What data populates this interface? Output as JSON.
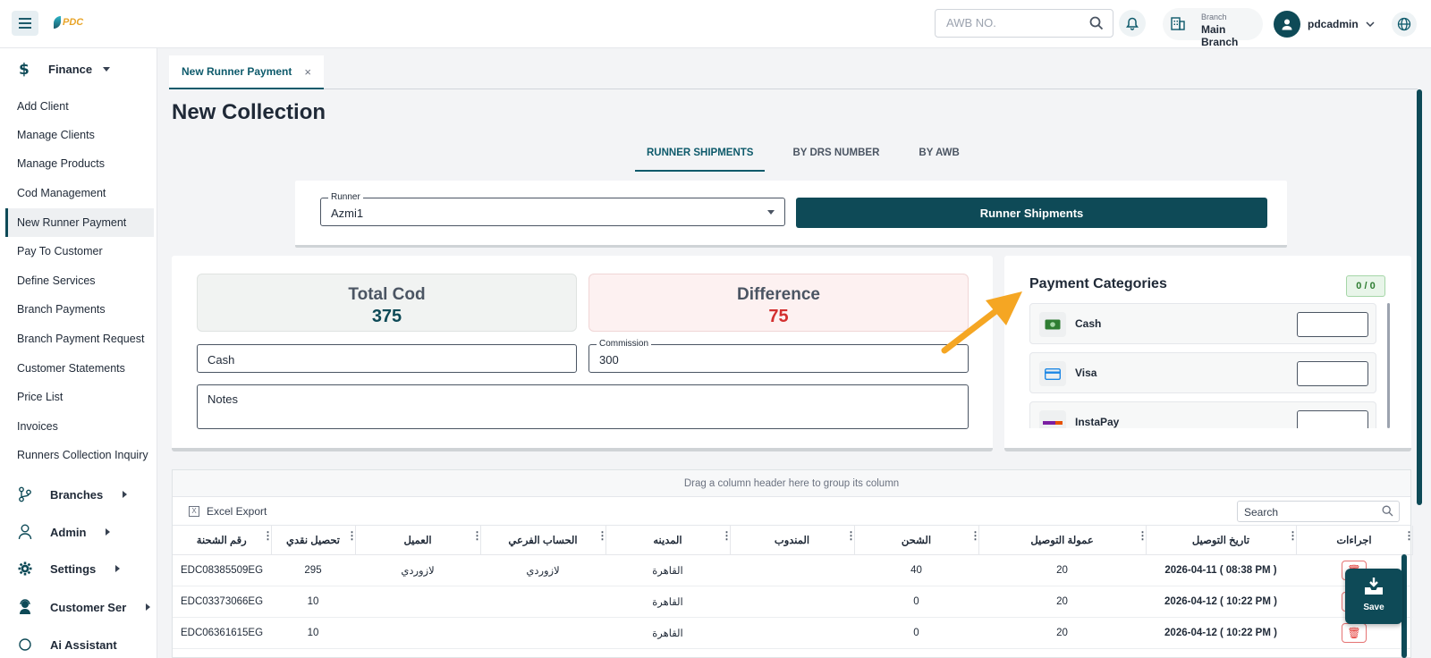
{
  "topbar": {
    "logo_text": "PDC",
    "search_placeholder": "AWB NO.",
    "branch_label": "Branch",
    "branch_value": "Main Branch",
    "username": "pdcadmin"
  },
  "sidebar": {
    "finance_label": "Finance",
    "items": [
      {
        "label": "Add Client"
      },
      {
        "label": "Manage Clients"
      },
      {
        "label": "Manage Products"
      },
      {
        "label": "Cod Management"
      },
      {
        "label": "New Runner Payment"
      },
      {
        "label": "Pay To Customer"
      },
      {
        "label": "Define Services"
      },
      {
        "label": "Branch Payments"
      },
      {
        "label": "Branch Payment Request"
      },
      {
        "label": "Customer Statements"
      },
      {
        "label": "Price List"
      },
      {
        "label": "Invoices"
      },
      {
        "label": "Runners Collection Inquiry"
      }
    ],
    "active_item": "New Runner Payment",
    "sections": {
      "branches": "Branches",
      "admin": "Admin",
      "settings": "Settings",
      "customer_ser": "Customer Ser",
      "ai_assistant": "Ai Assistant"
    }
  },
  "tabs": {
    "active_tab": "New Runner Payment",
    "close_glyph": "×"
  },
  "page": {
    "title": "New Collection",
    "subtabs": [
      "RUNNER SHIPMENTS",
      "BY DRS NUMBER",
      "BY AWB"
    ],
    "active_subtab": "RUNNER SHIPMENTS"
  },
  "runner": {
    "label": "Runner",
    "value": "Azmi1",
    "button": "Runner Shipments"
  },
  "cod": {
    "total_label": "Total Cod",
    "total_value": "375",
    "diff_label": "Difference",
    "diff_value": "75",
    "cash_value": "Cash",
    "commission_label": "Commission",
    "commission_value": "300",
    "notes_placeholder": "Notes"
  },
  "payment": {
    "title": "Payment Categories",
    "count": "0 / 0",
    "categories": [
      {
        "name": "Cash",
        "icon": "cash-icon"
      },
      {
        "name": "Visa",
        "icon": "card-icon"
      },
      {
        "name": "InstaPay",
        "icon": "instapay-icon"
      }
    ]
  },
  "grid": {
    "group_hint": "Drag a column header here to group its column",
    "excel_label": "Excel Export",
    "search_placeholder": "Search",
    "columns": [
      "رقم الشحنة",
      "تحصيل نقدي",
      "العميل",
      "الحساب الفرعي",
      "المدينه",
      "المندوب",
      "الشحن",
      "عمولة التوصيل",
      "تاريخ التوصيل",
      "اجراءات"
    ],
    "rows": [
      {
        "awb": "EDC08385509EG",
        "cod": "295",
        "client": "لازوردي",
        "sub_account": "لازوردي",
        "city": "القاهرة",
        "runner": "",
        "shipping": "40",
        "commission": "20",
        "date": "2026-04-11 ( 08:38 PM )"
      },
      {
        "awb": "EDC03373066EG",
        "cod": "10",
        "client": "",
        "sub_account": "",
        "city": "القاهرة",
        "runner": "",
        "shipping": "0",
        "commission": "20",
        "date": "2026-04-12 ( 10:22 PM )"
      },
      {
        "awb": "EDC06361615EG",
        "cod": "10",
        "client": "",
        "sub_account": "",
        "city": "القاهرة",
        "runner": "",
        "shipping": "0",
        "commission": "20",
        "date": "2026-04-12 ( 10:22 PM )"
      }
    ]
  },
  "save_label": "Save",
  "colors": {
    "primary": "#0e4a57",
    "danger": "#d32f2f",
    "arrow": "#f5a623"
  }
}
